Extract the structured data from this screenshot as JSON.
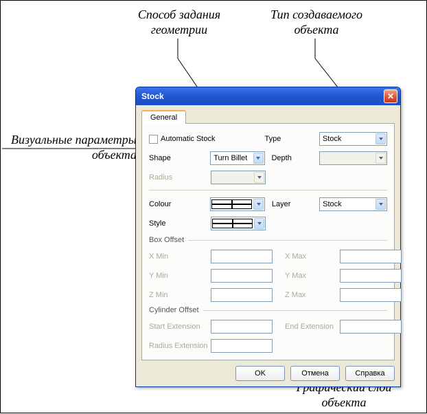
{
  "annotations": {
    "geometry_method": "Способ задания\nгеометрии",
    "object_type": "Тип создаваемого\nобъекта",
    "visual_params": "Визуальные параметры\nобъекта",
    "graphic_layer": "Графический слой\nобъекта"
  },
  "dialog": {
    "title": "Stock",
    "tab_general": "General",
    "automatic_stock": "Automatic Stock",
    "type_label": "Type",
    "type_value": "Stock",
    "shape_label": "Shape",
    "shape_value": "Turn Billet",
    "depth_label": "Depth",
    "radius_label": "Radius",
    "colour_label": "Colour",
    "layer_label": "Layer",
    "layer_value": "Stock",
    "style_label": "Style",
    "box_offset_label": "Box Offset",
    "xmin": "X Min",
    "xmax": "X Max",
    "ymin": "Y Min",
    "ymax": "Y Max",
    "zmin": "Z Min",
    "zmax": "Z Max",
    "cylinder_offset_label": "Cylinder Offset",
    "start_ext": "Start Extension",
    "end_ext": "End Extension",
    "radius_ext": "Radius Extension",
    "ok": "OK",
    "cancel": "Отмена",
    "help": "Справка"
  }
}
